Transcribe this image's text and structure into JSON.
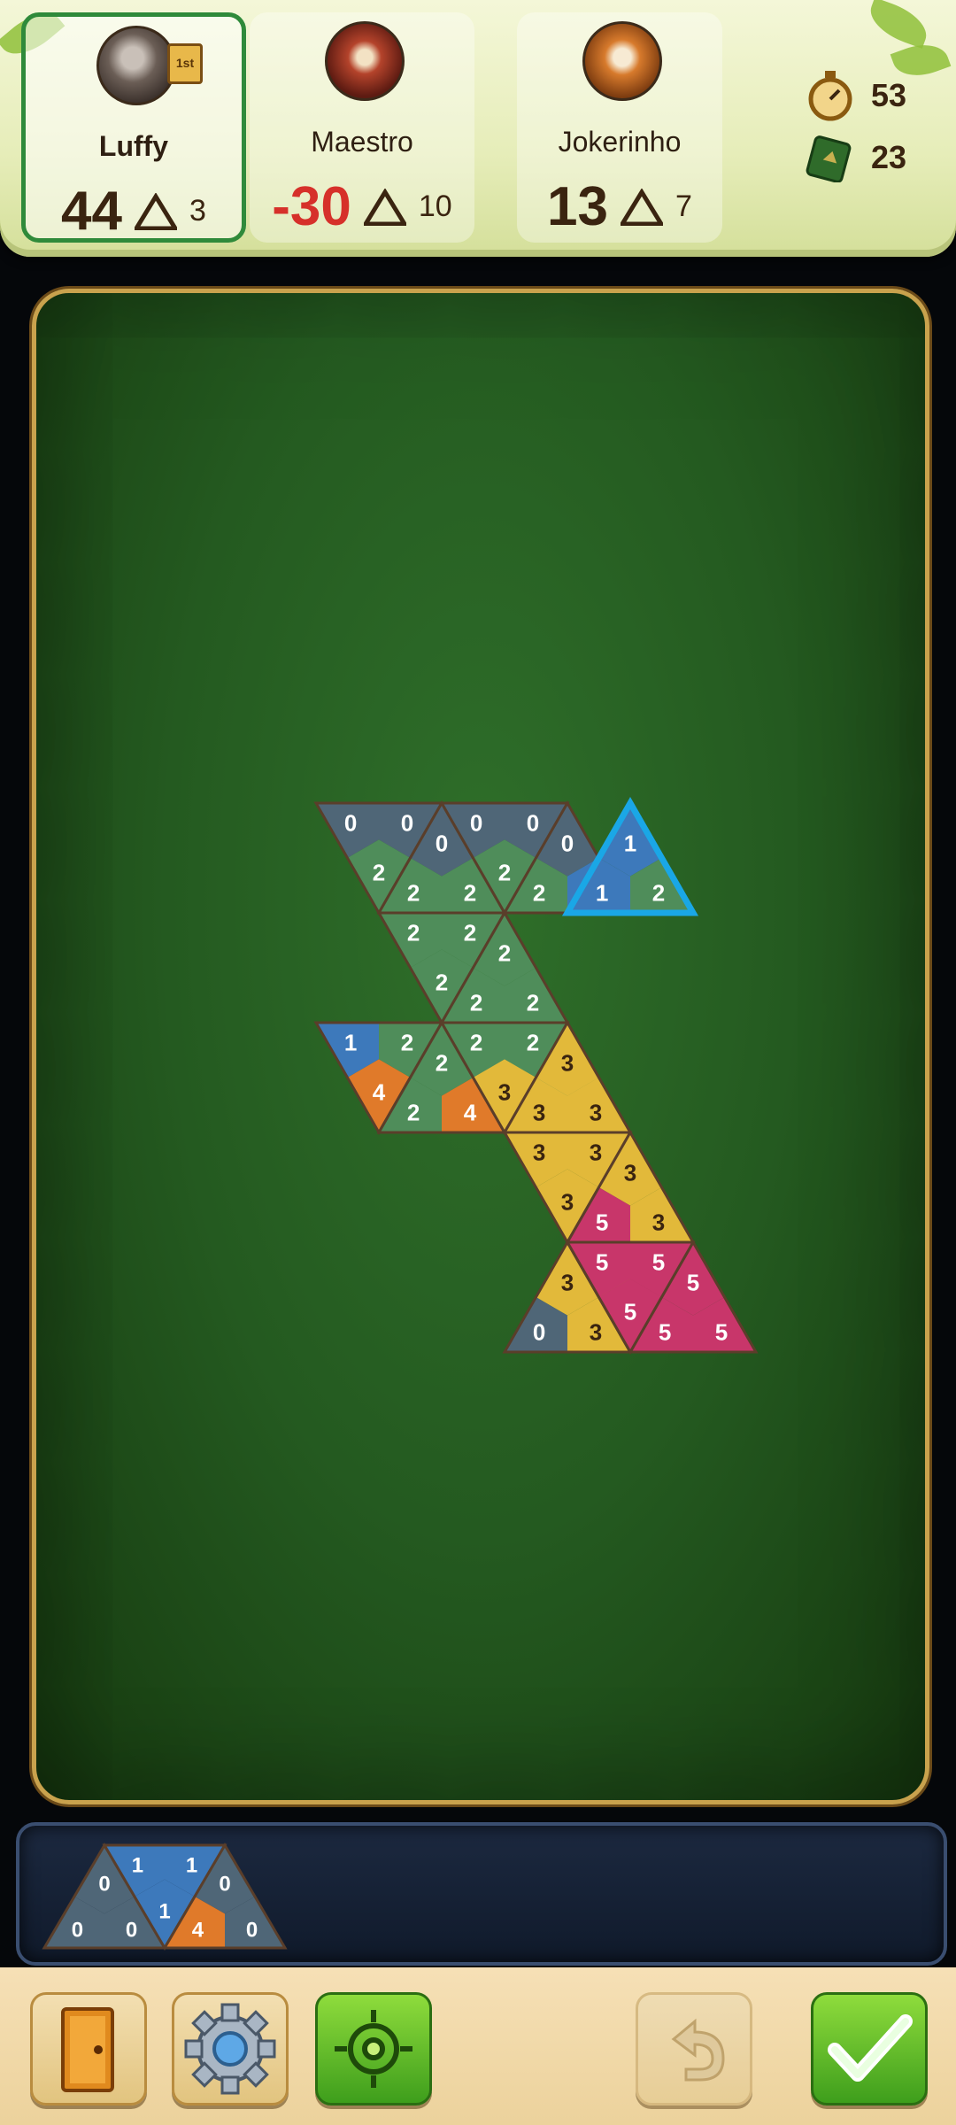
{
  "players": [
    {
      "name": "Luffy",
      "score": "44",
      "tiles": "3",
      "badge": "1st"
    },
    {
      "name": "Maestro",
      "score": "-30",
      "tiles": "10"
    },
    {
      "name": "Jokerinho",
      "score": "13",
      "tiles": "7"
    }
  ],
  "stats": {
    "timer": "53",
    "pool": "23"
  },
  "board": {
    "tiles": [
      {
        "c": [
          "0",
          "0",
          "2"
        ]
      },
      {
        "c": [
          "0",
          "2",
          "2"
        ]
      },
      {
        "c": [
          "0",
          "0",
          "2"
        ]
      },
      {
        "c": [
          "0",
          "1",
          "2"
        ]
      },
      {
        "c": [
          "1",
          "2",
          "1"
        ]
      },
      {
        "c": [
          "2",
          "2",
          "2"
        ]
      },
      {
        "c": [
          "2",
          "2",
          "2"
        ]
      },
      {
        "c": [
          "2",
          "2",
          "2"
        ]
      },
      {
        "c": [
          "2",
          "3",
          "2"
        ]
      },
      {
        "c": [
          "1",
          "2",
          "4"
        ]
      },
      {
        "c": [
          "2",
          "4",
          "2"
        ]
      },
      {
        "c": [
          "2",
          "2",
          "3"
        ]
      },
      {
        "c": [
          "3",
          "3",
          "3"
        ]
      },
      {
        "c": [
          "3",
          "3",
          "3"
        ]
      },
      {
        "c": [
          "3",
          "3",
          "5"
        ]
      },
      {
        "c": [
          "3",
          "3",
          "0"
        ]
      },
      {
        "c": [
          "3",
          "5",
          "5"
        ]
      },
      {
        "c": [
          "5",
          "5",
          "5"
        ]
      },
      {
        "c": [
          "5",
          "5",
          "5"
        ]
      }
    ]
  },
  "hand": {
    "tiles": [
      {
        "c": [
          "0",
          "0",
          "0"
        ]
      },
      {
        "c": [
          "1",
          "1",
          "1"
        ]
      },
      {
        "c": [
          "0",
          "0",
          "4"
        ]
      }
    ]
  },
  "colors": {
    "0": "#4f6677",
    "1": "#3d79bb",
    "2": "#4f8d5a",
    "3": "#e2b93a",
    "4": "#e07a2a",
    "5": "#c8366a",
    "highlight": "#1aa7e6",
    "accent_green": "#2f8a3a"
  },
  "buttons": [
    "exit-door-icon",
    "settings-gear-icon",
    "recenter-target-icon",
    "undo-arrow-icon",
    "confirm-check-icon"
  ]
}
